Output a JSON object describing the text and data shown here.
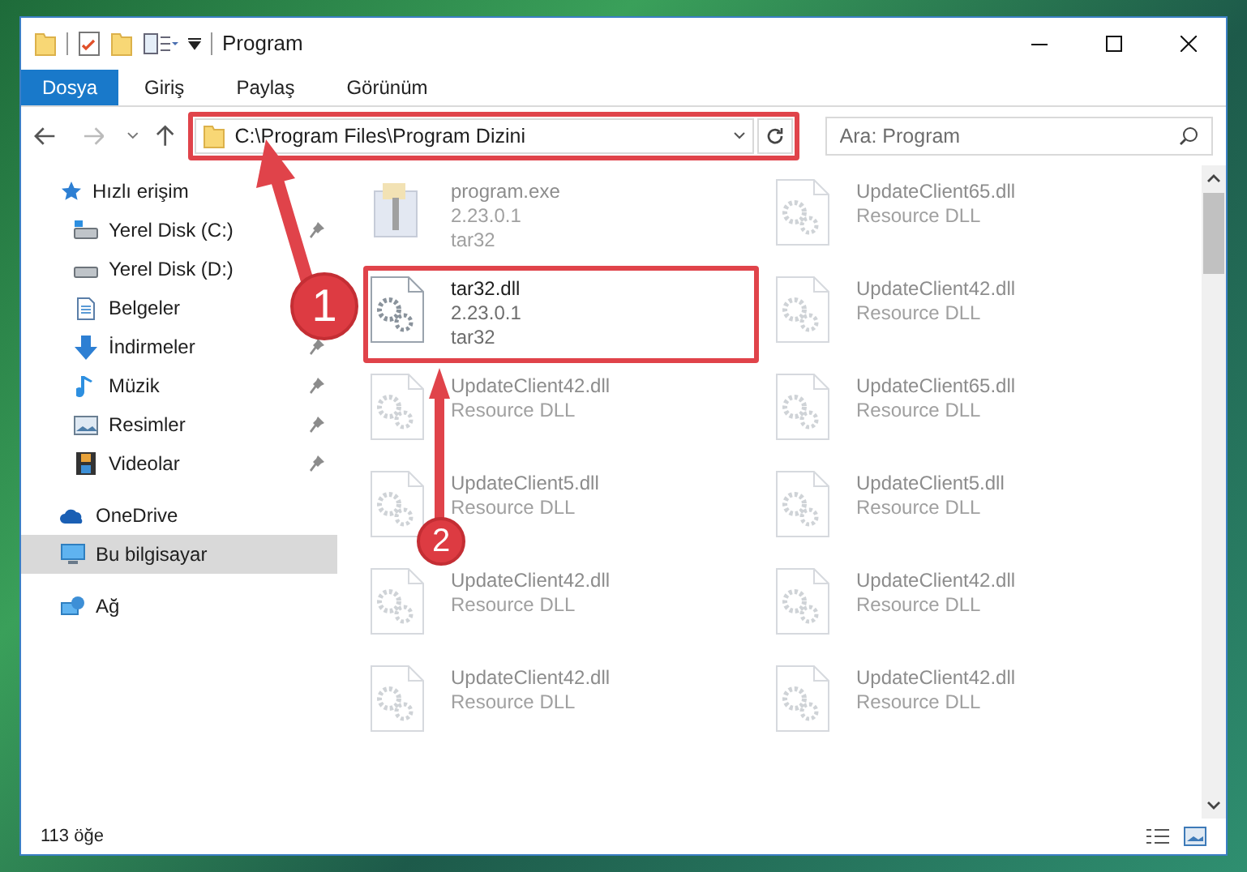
{
  "window": {
    "title": "Program"
  },
  "ribbon_tabs": [
    {
      "label": "Dosya",
      "selected": true
    },
    {
      "label": "Giriş",
      "selected": false
    },
    {
      "label": "Paylaş",
      "selected": false
    },
    {
      "label": "Görünüm",
      "selected": false
    }
  ],
  "address_bar": {
    "path": "C:\\Program Files\\Program Dizini"
  },
  "search": {
    "placeholder": "Ara: Program"
  },
  "sidebar": {
    "items": [
      {
        "label": "Hızlı erişim",
        "selected": false,
        "children": [
          {
            "label": "Yerel Disk (C:)",
            "pinned": true,
            "selected": false
          },
          {
            "label": "Yerel Disk (D:)",
            "selected": false
          },
          {
            "label": "Belgeler",
            "selected": false
          },
          {
            "label": "İndirmeler",
            "pinned": true,
            "selected": false
          },
          {
            "label": "Müzik",
            "pinned": true,
            "selected": false
          },
          {
            "label": "Resimler",
            "pinned": true,
            "selected": false
          },
          {
            "label": "Videolar",
            "pinned": true,
            "selected": false
          }
        ]
      },
      {
        "label": "OneDrive",
        "selected": false
      },
      {
        "label": "Bu bilgisayar",
        "selected": true
      },
      {
        "label": "Ağ",
        "selected": false
      }
    ]
  },
  "files": [
    {
      "name": "program.exe",
      "lines": [
        "2.23.0.1",
        "tar32"
      ],
      "kind": "exe",
      "highlighted": false
    },
    {
      "name": "UpdateClient65.dll",
      "lines": [
        "Resource DLL"
      ],
      "kind": "dll",
      "highlighted": false
    },
    {
      "name": "tar32.dll",
      "lines": [
        "2.23.0.1",
        "tar32"
      ],
      "kind": "dll",
      "highlighted": true
    },
    {
      "name": "UpdateClient42.dll",
      "lines": [
        "Resource DLL"
      ],
      "kind": "dll",
      "highlighted": false
    },
    {
      "name": "UpdateClient42.dll",
      "lines": [
        "Resource DLL"
      ],
      "kind": "dll",
      "highlighted": false
    },
    {
      "name": "UpdateClient65.dll",
      "lines": [
        "Resource DLL"
      ],
      "kind": "dll",
      "highlighted": false
    },
    {
      "name": "UpdateClient5.dll",
      "lines": [
        "Resource DLL"
      ],
      "kind": "dll",
      "highlighted": false
    },
    {
      "name": "UpdateClient5.dll",
      "lines": [
        "Resource DLL"
      ],
      "kind": "dll",
      "highlighted": false
    },
    {
      "name": "UpdateClient42.dll",
      "lines": [
        "Resource DLL"
      ],
      "kind": "dll",
      "highlighted": false
    },
    {
      "name": "UpdateClient42.dll",
      "lines": [
        "Resource DLL"
      ],
      "kind": "dll",
      "highlighted": false
    },
    {
      "name": "UpdateClient42.dll",
      "lines": [
        "Resource DLL"
      ],
      "kind": "dll",
      "highlighted": false
    },
    {
      "name": "UpdateClient42.dll",
      "lines": [
        "Resource DLL"
      ],
      "kind": "dll",
      "highlighted": false
    }
  ],
  "status_bar": {
    "count": "113 öğe"
  },
  "annotations": [
    {
      "label": "1"
    },
    {
      "label": "2"
    }
  ]
}
